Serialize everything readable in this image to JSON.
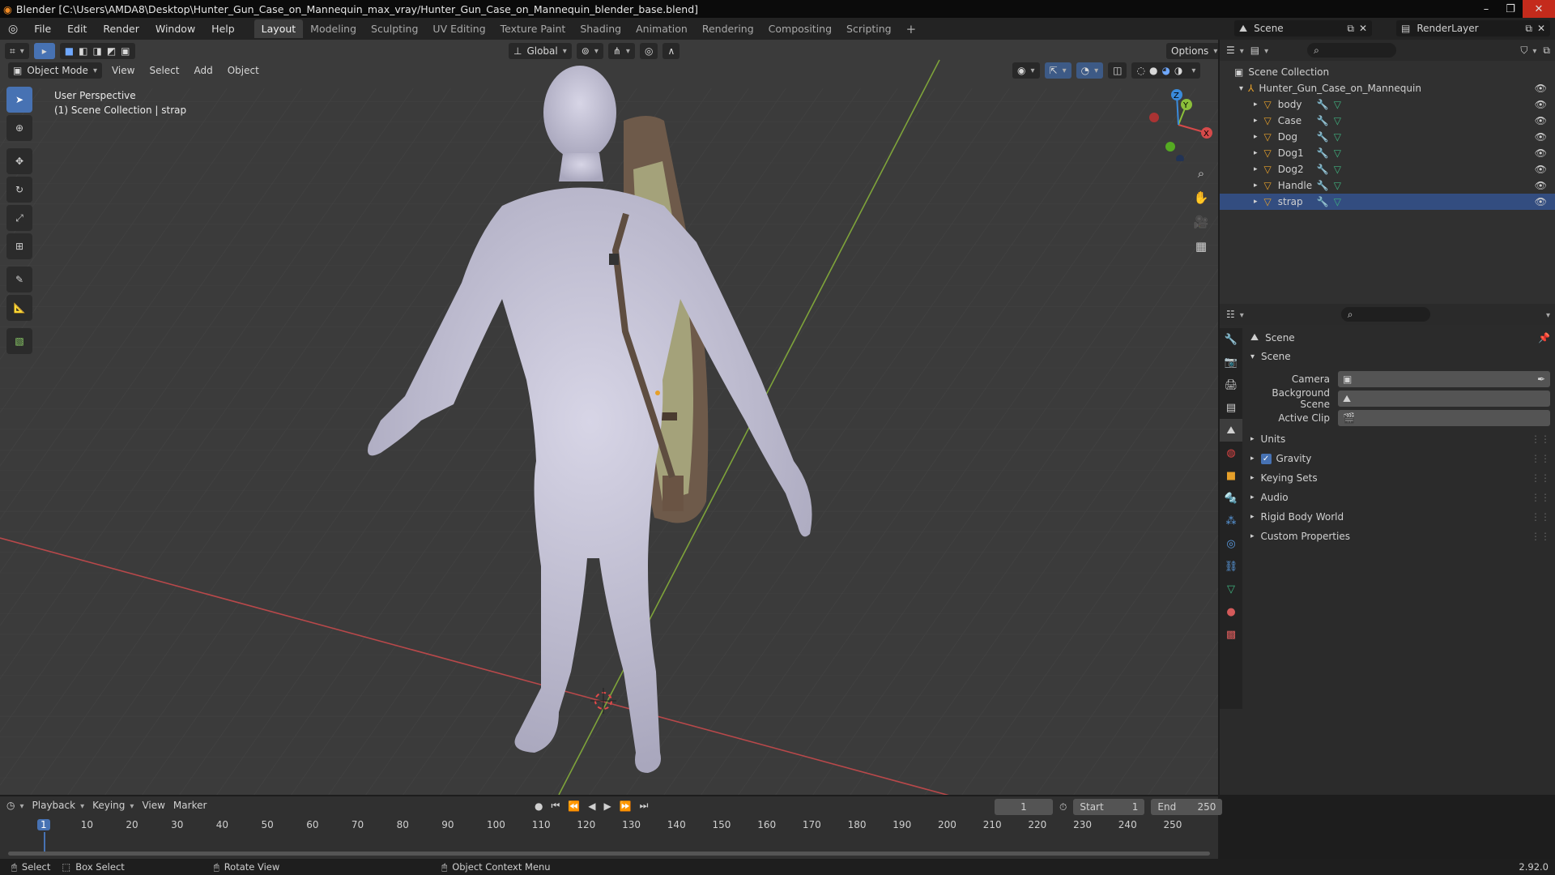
{
  "window": {
    "title": "Blender [C:\\Users\\AMDA8\\Desktop\\Hunter_Gun_Case_on_Mannequin_max_vray/Hunter_Gun_Case_on_Mannequin_blender_base.blend]",
    "controls": [
      "–",
      "❐",
      "✕"
    ]
  },
  "menu": {
    "items": [
      "File",
      "Edit",
      "Render",
      "Window",
      "Help"
    ]
  },
  "workspaces": {
    "tabs": [
      "Layout",
      "Modeling",
      "Sculpting",
      "UV Editing",
      "Texture Paint",
      "Shading",
      "Animation",
      "Rendering",
      "Compositing",
      "Scripting"
    ],
    "active": "Layout",
    "add": "+"
  },
  "scene_selector": {
    "label": "Scene",
    "render_layer": "RenderLayer"
  },
  "viewport": {
    "transform_orientation": "Global",
    "options_label": "Options",
    "mode": "Object Mode",
    "header_menus": [
      "View",
      "Select",
      "Add",
      "Object"
    ],
    "overlay_title": "User Perspective",
    "overlay_subtitle": "(1) Scene Collection | strap",
    "gizmo": {
      "x": "X",
      "y": "Y",
      "z": "Z"
    }
  },
  "outliner": {
    "root": "Scene Collection",
    "collection": "Hunter_Gun_Case_on_Mannequin",
    "objects": [
      "body",
      "Case",
      "Dog",
      "Dog1",
      "Dog2",
      "Handle",
      "strap"
    ]
  },
  "properties": {
    "context": "Scene",
    "panel_title": "Scene",
    "fields": [
      {
        "label": "Camera",
        "value": ""
      },
      {
        "label": "Background Scene",
        "value": ""
      },
      {
        "label": "Active Clip",
        "value": ""
      }
    ],
    "sections": [
      {
        "label": "Units",
        "checkbox": false
      },
      {
        "label": "Gravity",
        "checkbox": true
      },
      {
        "label": "Keying Sets",
        "checkbox": false
      },
      {
        "label": "Audio",
        "checkbox": false
      },
      {
        "label": "Rigid Body World",
        "checkbox": false
      },
      {
        "label": "Custom Properties",
        "checkbox": false
      }
    ]
  },
  "timeline": {
    "menus": [
      "Playback",
      "Keying",
      "View",
      "Marker"
    ],
    "current_frame": "1",
    "start_label": "Start",
    "start": "1",
    "end_label": "End",
    "end": "250",
    "ticks": [
      "1",
      "10",
      "20",
      "30",
      "40",
      "50",
      "60",
      "70",
      "80",
      "90",
      "100",
      "110",
      "120",
      "130",
      "140",
      "150",
      "160",
      "170",
      "180",
      "190",
      "200",
      "210",
      "220",
      "230",
      "240",
      "250"
    ]
  },
  "statusbar": {
    "items": [
      "Select",
      "Box Select",
      "Rotate View",
      "Object Context Menu"
    ],
    "version": "2.92.0"
  },
  "colors": {
    "accent": "#4772b3",
    "x_axis": "#d64a4a",
    "y_axis": "#8bbf3a",
    "z_axis": "#3a8bdc",
    "mannequin": "#c9c7d8"
  }
}
